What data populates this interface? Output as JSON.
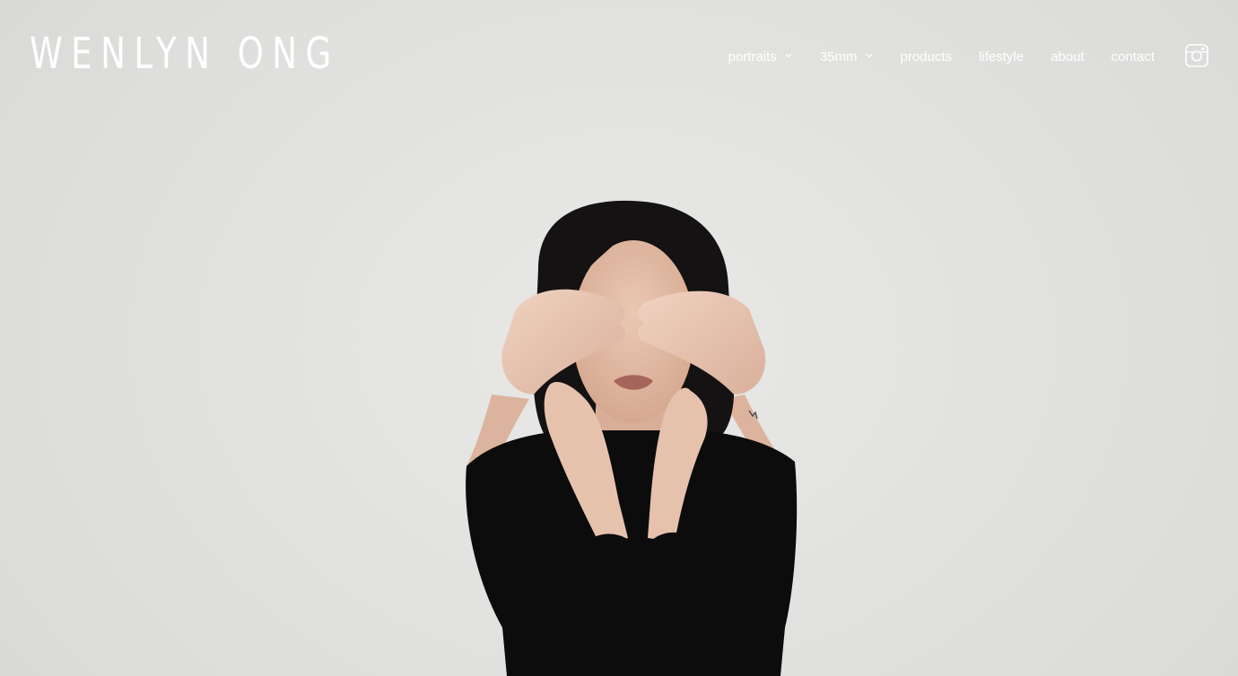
{
  "header": {
    "site_title": "WENLYN ONG"
  },
  "nav": {
    "items": [
      {
        "label": "portraits",
        "has_dropdown": true
      },
      {
        "label": "35mm",
        "has_dropdown": true
      },
      {
        "label": "products",
        "has_dropdown": false
      },
      {
        "label": "lifestyle",
        "has_dropdown": false
      },
      {
        "label": "about",
        "has_dropdown": false
      },
      {
        "label": "contact",
        "has_dropdown": false
      }
    ],
    "social_icon": "instagram-icon"
  },
  "colors": {
    "nav_text": "#ffffff",
    "background": "#e2e2e0",
    "garment": "#0c0c0c",
    "hair": "#141212",
    "skin": "#e2bca6"
  }
}
